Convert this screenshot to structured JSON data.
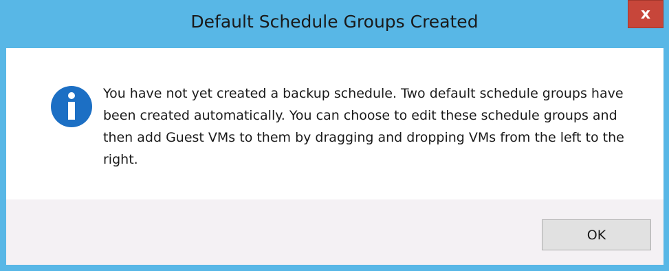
{
  "dialog": {
    "title": "Default Schedule Groups Created",
    "close_label": "x",
    "message": "You have not yet created a backup schedule.  Two default schedule groups have been created automatically.  You can choose to edit these schedule groups and then add Guest VMs to them by dragging and dropping VMs from the left to the right.",
    "icon": "info-icon",
    "ok_label": "OK"
  },
  "colors": {
    "frame": "#58b7e6",
    "close_button": "#c7463a",
    "footer": "#f4f1f4",
    "icon": "#1c6fc4"
  }
}
